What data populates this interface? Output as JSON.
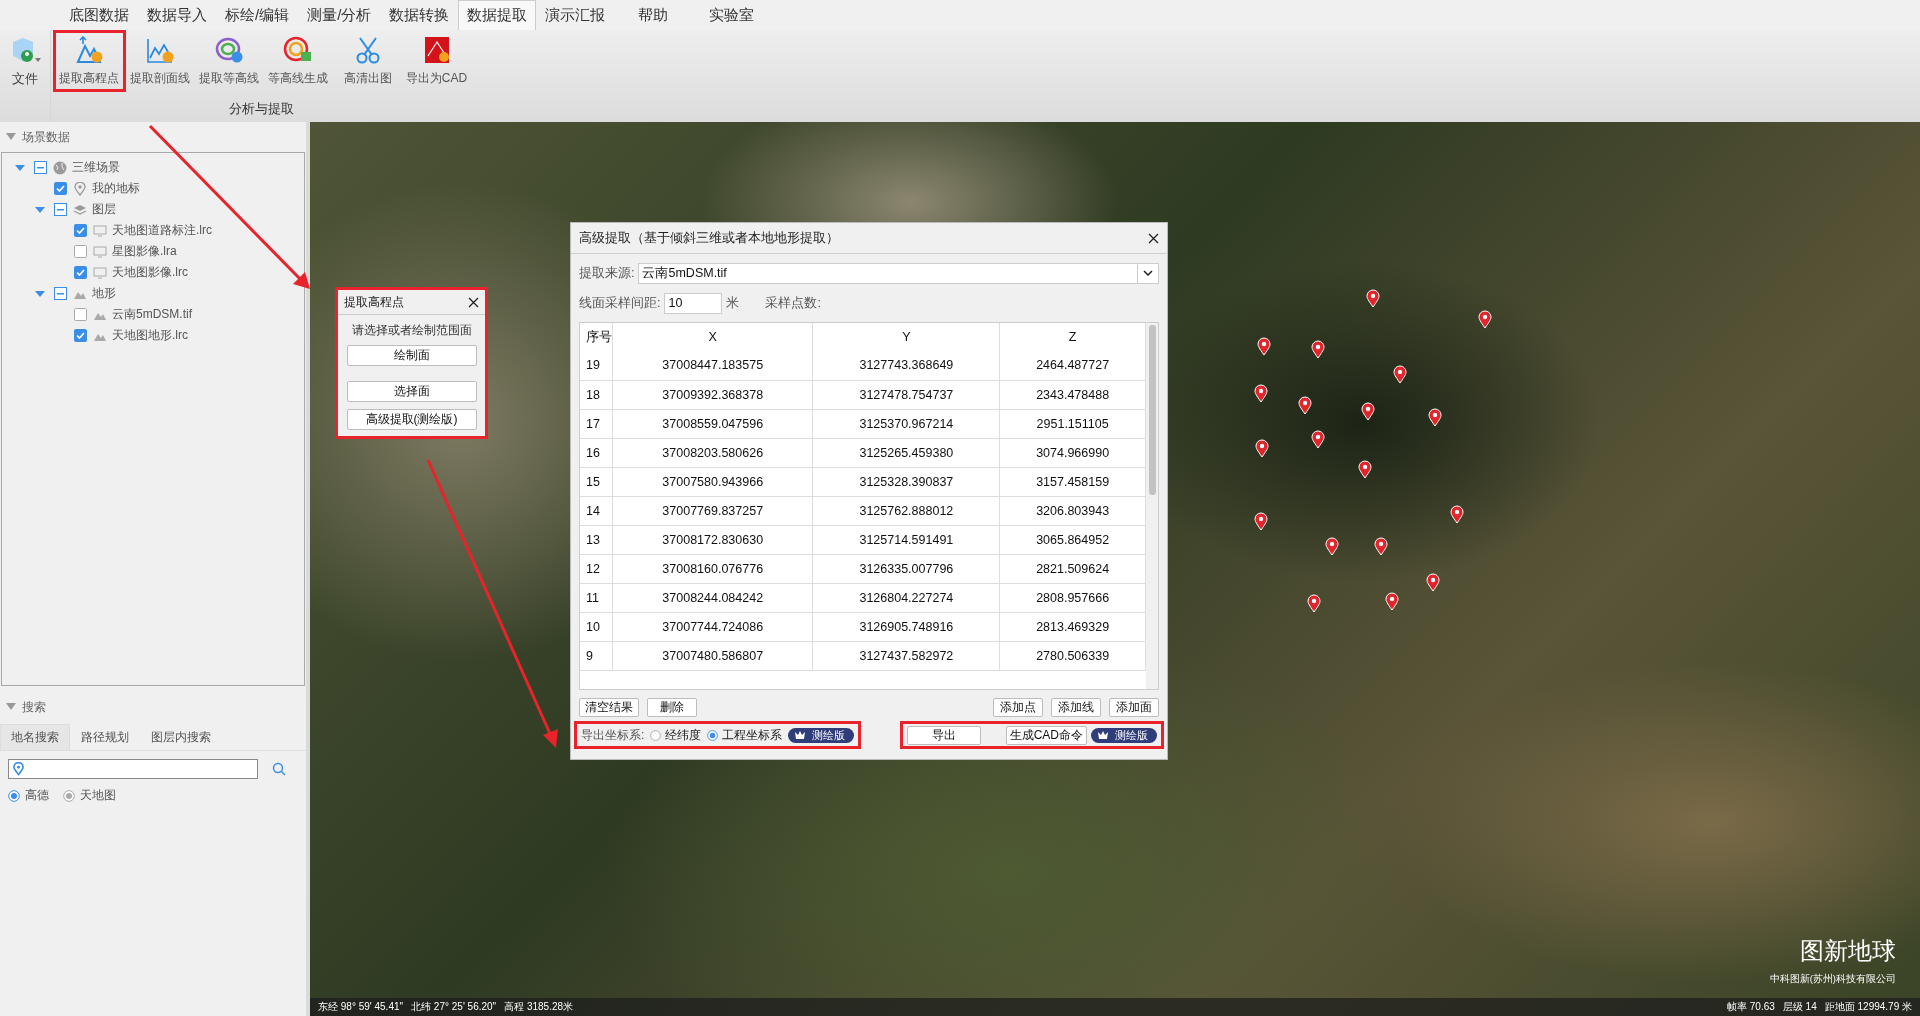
{
  "ribbon": {
    "tabs": [
      {
        "label": "底图数据",
        "selected": false
      },
      {
        "label": "数据导入",
        "selected": false
      },
      {
        "label": "标绘/编辑",
        "selected": false
      },
      {
        "label": "测量/分析",
        "selected": false
      },
      {
        "label": "数据转换",
        "selected": false
      },
      {
        "label": "数据提取",
        "selected": true
      },
      {
        "label": "演示汇报",
        "selected": false
      },
      {
        "label": "帮助",
        "selected": false
      },
      {
        "label": "实验室",
        "selected": false
      }
    ],
    "file_button": "文件",
    "buttons": [
      {
        "label": "提取高程点",
        "kind": "elevation",
        "highlighted": true
      },
      {
        "label": "提取剖面线",
        "kind": "profile",
        "highlighted": false
      },
      {
        "label": "提取等高线",
        "kind": "contour",
        "highlighted": false
      },
      {
        "label": "等高线生成",
        "kind": "contourgen",
        "highlighted": false
      },
      {
        "label": "高清出图",
        "kind": "scissors",
        "highlighted": false
      },
      {
        "label": "导出为CAD",
        "kind": "cad",
        "highlighted": false
      }
    ],
    "group_label": "分析与提取"
  },
  "sidebar": {
    "scene_header": "场景数据",
    "tree": [
      {
        "label": "三维场景",
        "kind": "globe",
        "expanded": true,
        "children": [
          {
            "label": "我的地标",
            "kind": "pin",
            "checked": true
          },
          {
            "label": "图层",
            "kind": "layers",
            "expanded": true,
            "children": [
              {
                "label": "天地图道路标注.lrc",
                "kind": "monitor",
                "checked": true
              },
              {
                "label": "星图影像.lra",
                "kind": "monitor",
                "checked": false
              },
              {
                "label": "天地图影像.lrc",
                "kind": "monitor",
                "checked": true
              }
            ]
          },
          {
            "label": "地形",
            "kind": "terrain",
            "expanded": true,
            "children": [
              {
                "label": "云南5mDSM.tif",
                "kind": "terrain",
                "checked": false
              },
              {
                "label": "天地图地形.lrc",
                "kind": "terrain",
                "checked": true
              }
            ]
          }
        ]
      }
    ],
    "search_header": "搜索",
    "search_tabs": [
      {
        "label": "地名搜索",
        "selected": true
      },
      {
        "label": "路径规划",
        "selected": false
      },
      {
        "label": "图层内搜索",
        "selected": false
      }
    ],
    "map_sources": [
      {
        "label": "高德",
        "selected": true
      },
      {
        "label": "天地图",
        "selected": false
      }
    ]
  },
  "popup": {
    "title": "提取高程点",
    "prompt": "请选择或者绘制范围面",
    "buttons": [
      "绘制面",
      "选择面",
      "高级提取(测绘版)"
    ],
    "highlighted": true
  },
  "dialog": {
    "title": "高级提取（基于倾斜三维或者本地地形提取）",
    "source_label": "提取来源:",
    "source_value": "云南5mDSM.tif",
    "spacing_label": "线面采样间距:",
    "spacing_value": "10",
    "spacing_unit": "米",
    "count_label": "采样点数:",
    "columns": [
      "序号",
      "X",
      "Y",
      "Z"
    ],
    "rows": [
      [
        "19",
        "37008447.183575",
        "3127743.368649",
        "2464.487727"
      ],
      [
        "18",
        "37009392.368378",
        "3127478.754737",
        "2343.478488"
      ],
      [
        "17",
        "37008559.047596",
        "3125370.967214",
        "2951.151105"
      ],
      [
        "16",
        "37008203.580626",
        "3125265.459380",
        "3074.966990"
      ],
      [
        "15",
        "37007580.943966",
        "3125328.390837",
        "3157.458159"
      ],
      [
        "14",
        "37007769.837257",
        "3125762.888012",
        "3206.803943"
      ],
      [
        "13",
        "37008172.830630",
        "3125714.591491",
        "3065.864952"
      ],
      [
        "12",
        "37008160.076776",
        "3126335.007796",
        "2821.509624"
      ],
      [
        "11",
        "37008244.084242",
        "3126804.227274",
        "2808.957666"
      ],
      [
        "10",
        "37007744.724086",
        "3126905.748916",
        "2813.469329"
      ],
      [
        "9",
        "37007480.586807",
        "3127437.582972",
        "2780.506339"
      ]
    ],
    "left_buttons": [
      "清空结果",
      "删除"
    ],
    "right_buttons": [
      "添加点",
      "添加线",
      "添加面"
    ],
    "export_group": {
      "label": "导出坐标系:",
      "options": [
        {
          "label": "经纬度",
          "selected": false
        },
        {
          "label": "工程坐标系",
          "selected": true
        }
      ],
      "badge": "测绘版",
      "highlighted": true
    },
    "cad_group": {
      "buttons": [
        "导出",
        "生成CAD命令"
      ],
      "badge": "测绘版",
      "highlighted": true
    }
  },
  "map": {
    "logo": "图新地球",
    "company": "中科图新(苏州)科技有限公司",
    "status_left": [
      "东经 98° 59' 45.41\"",
      "北纬 27° 25' 56.20\"",
      "高程 3185.28米"
    ],
    "status_right": [
      "帧率 70.63",
      "层级 14",
      "距地面 12994.79 米"
    ]
  }
}
